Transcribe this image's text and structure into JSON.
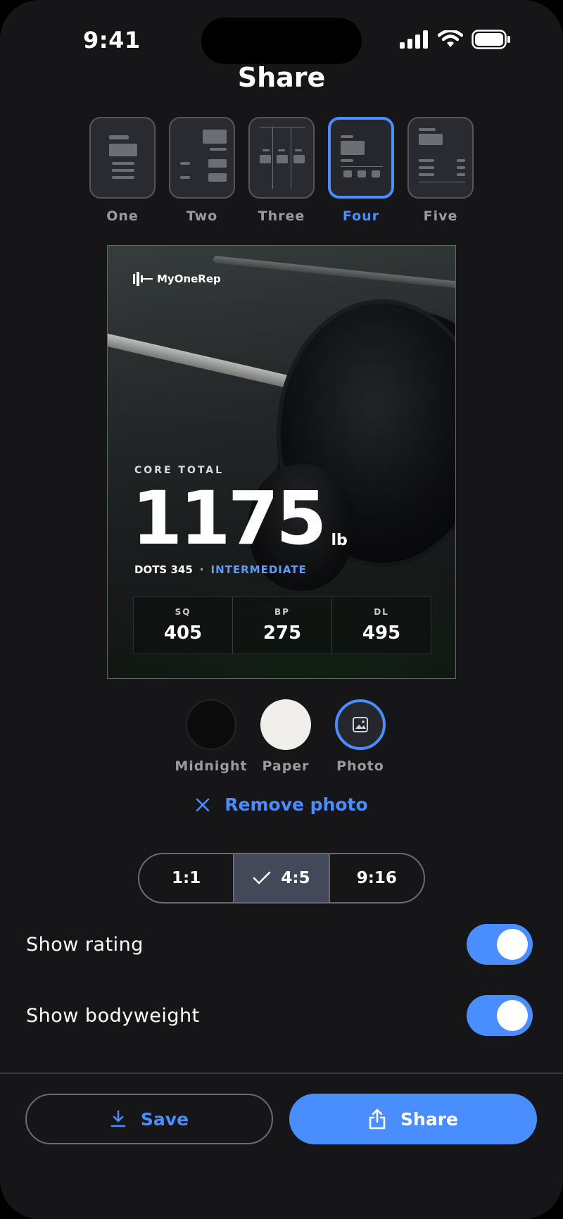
{
  "status_bar": {
    "time": "9:41",
    "icons": [
      "cellular-signal-icon",
      "wifi-icon",
      "battery-icon"
    ]
  },
  "header": {
    "title": "Share"
  },
  "layouts": {
    "selected": "Four",
    "options": [
      {
        "label": "One"
      },
      {
        "label": "Two"
      },
      {
        "label": "Three"
      },
      {
        "label": "Four"
      },
      {
        "label": "Five"
      }
    ]
  },
  "card": {
    "brand": "MyOneRep",
    "brand_icon": "barbell-logo-icon",
    "core_label": "CORE TOTAL",
    "total": "1175",
    "unit": "lb",
    "dots": "DOTS 345",
    "separator": "·",
    "tier": "INTERMEDIATE",
    "lifts": [
      {
        "name": "SQ",
        "value": "405"
      },
      {
        "name": "BP",
        "value": "275"
      },
      {
        "name": "DL",
        "value": "495"
      }
    ]
  },
  "themes": {
    "selected": "Photo",
    "options": [
      {
        "label": "Midnight",
        "color": "#0b0b0c"
      },
      {
        "label": "Paper",
        "color": "#f1efeb"
      },
      {
        "label": "Photo",
        "icon": "image-icon"
      }
    ]
  },
  "remove_photo": {
    "label": "Remove photo",
    "icon": "close-icon"
  },
  "aspect": {
    "selected": "4:5",
    "options": [
      {
        "label": "1:1"
      },
      {
        "label": "4:5"
      },
      {
        "label": "9:16"
      }
    ]
  },
  "settings": {
    "show_rating": {
      "label": "Show rating",
      "on": true
    },
    "show_bodyweight": {
      "label": "Show bodyweight",
      "on": true
    }
  },
  "actions": {
    "save_label": "Save",
    "save_icon": "download-icon",
    "share_label": "Share",
    "share_icon": "share-icon"
  },
  "colors": {
    "accent": "#4a8dff",
    "background": "#161618",
    "segment_selected": "#434959"
  }
}
